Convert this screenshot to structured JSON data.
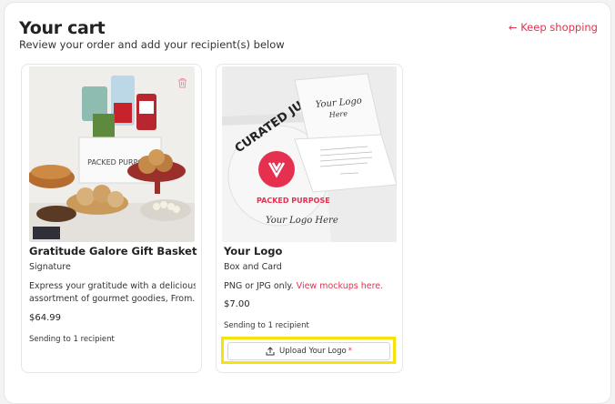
{
  "header": {
    "title": "Your cart",
    "subtitle": "Review your order and add your recipient(s) below",
    "keep_shopping": "← Keep shopping"
  },
  "items": [
    {
      "name": "Gratitude Galore Gift Basket",
      "variant": "Signature",
      "description": "Express your gratitude with a delicious assortment of gourmet goodies, From...",
      "description_line1": "Express your gratitude with a delicious",
      "description_line2": "assortment of gourmet goodies, From...",
      "price": "$64.99",
      "sending": "Sending to 1 recipient",
      "image_text": "PACKED PURPOSE",
      "icon": "trash-icon"
    },
    {
      "name": "Your Logo",
      "variant": "Box and Card",
      "file_note": "PNG or JPG only. ",
      "mockups_link": "View mockups here.",
      "price": "$7.00",
      "sending": "Sending to 1 recipient",
      "upload_label": "Upload Your Logo",
      "upload_required": "*",
      "image_text_curated": "CURATED JUS",
      "image_text_logo": "Your Logo Here",
      "image_text_brand": "PACKED PURPOSE"
    }
  ],
  "colors": {
    "accent": "#e5304f",
    "highlight": "#f5e30b"
  }
}
